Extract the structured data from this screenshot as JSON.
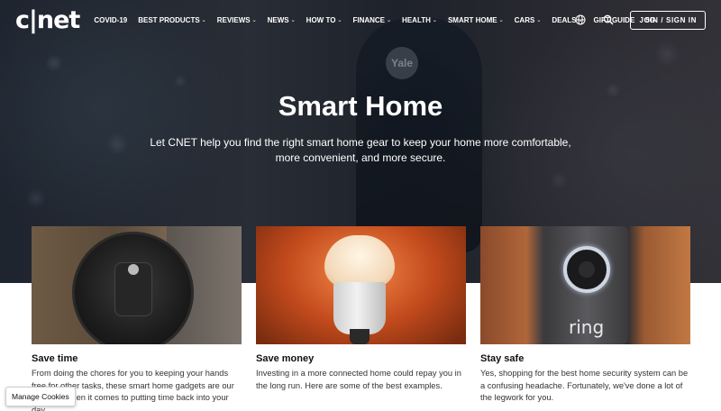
{
  "brand": {
    "logo_text": "c|net"
  },
  "nav": {
    "items": [
      {
        "label": "COVID-19",
        "has_dropdown": false
      },
      {
        "label": "BEST PRODUCTS",
        "has_dropdown": true
      },
      {
        "label": "REVIEWS",
        "has_dropdown": true
      },
      {
        "label": "NEWS",
        "has_dropdown": true
      },
      {
        "label": "HOW TO",
        "has_dropdown": true
      },
      {
        "label": "FINANCE",
        "has_dropdown": true
      },
      {
        "label": "HEALTH",
        "has_dropdown": true
      },
      {
        "label": "SMART HOME",
        "has_dropdown": true
      },
      {
        "label": "CARS",
        "has_dropdown": true
      },
      {
        "label": "DEALS",
        "has_dropdown": true
      },
      {
        "label": "GIFT GUIDE",
        "has_dropdown": false
      },
      {
        "label": "5G",
        "has_dropdown": false
      }
    ],
    "chevron": "⌄",
    "join_label": "JOIN / SIGN IN"
  },
  "hero": {
    "title": "Smart Home",
    "description": "Let CNET help you find the right smart home gear to keep your home more comfortable, more convenient, and more secure.",
    "device_badge": "Yale"
  },
  "cards": [
    {
      "title": "Save time",
      "text": "From doing the chores for you to keeping your hands free for other tasks, these smart home gadgets are our favorites when it comes to putting time back into your day."
    },
    {
      "title": "Save money",
      "text": "Investing in a more connected home could repay you in the long run. Here are some of the best examples."
    },
    {
      "title": "Stay safe",
      "text": "Yes, shopping for the best home security system can be a confusing headache. Fortunately, we've done a lot of the legwork for you.",
      "image_text": "ring"
    }
  ],
  "cookie": {
    "label": "Manage Cookies"
  },
  "colors": {
    "hero_text": "#ffffff",
    "body_text": "#333333",
    "title_text": "#111111"
  }
}
